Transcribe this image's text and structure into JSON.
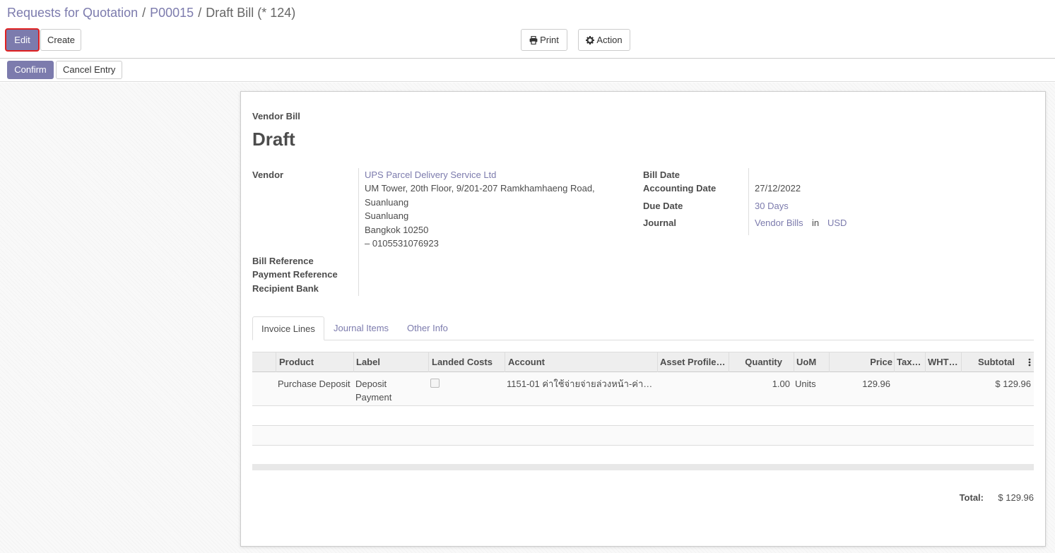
{
  "breadcrumb": {
    "item1": "Requests for Quotation",
    "item2": "P00015",
    "current": "Draft Bill (* 124)",
    "sep": "/"
  },
  "toolbar": {
    "edit": "Edit",
    "create": "Create",
    "print": "Print",
    "action": "Action",
    "print_icon": "print-icon",
    "action_icon": "gear-icon"
  },
  "statusbar": {
    "confirm": "Confirm",
    "cancel_entry": "Cancel Entry"
  },
  "sheet": {
    "doc_type": "Vendor Bill",
    "state": "Draft",
    "vendor_label": "Vendor",
    "vendor_name": "UPS Parcel Delivery Service Ltd",
    "vendor_address": [
      "UM Tower, 20th Floor, 9/201-207 Ramkhamhaeng Road,",
      "Suanluang",
      "Suanluang",
      "Bangkok 10250",
      "– 0105531076923"
    ],
    "bill_reference_label": "Bill Reference",
    "payment_reference_label": "Payment Reference",
    "recipient_bank_label": "Recipient Bank",
    "bill_date_label": "Bill Date",
    "accounting_date_label": "Accounting Date",
    "accounting_date": "27/12/2022",
    "due_date_label": "Due Date",
    "due_date": "30 Days",
    "journal_label": "Journal",
    "journal": "Vendor Bills",
    "journal_in": "in",
    "currency": "USD"
  },
  "tabs": {
    "invoice_lines": "Invoice Lines",
    "journal_items": "Journal Items",
    "other_info": "Other Info"
  },
  "table": {
    "headers": {
      "product": "Product",
      "label": "Label",
      "landed_costs": "Landed Costs",
      "account": "Account",
      "asset_profile": "Asset Profile…",
      "quantity": "Quantity",
      "uom": "UoM",
      "price": "Price",
      "taxes": "Tax…",
      "wht": "WHT…",
      "subtotal": "Subtotal"
    },
    "rows": [
      {
        "product": "Purchase Deposit",
        "label_line1": "Deposit",
        "label_line2": "Payment",
        "landed_costs": false,
        "account": "1151-01 ค่าใช้จ่ายจ่ายล่วงหน้า-ค่า…",
        "quantity": "1.00",
        "uom": "Units",
        "price": "129.96",
        "subtotal": "$ 129.96"
      }
    ]
  },
  "totals": {
    "label": "Total:",
    "value": "$ 129.96"
  }
}
